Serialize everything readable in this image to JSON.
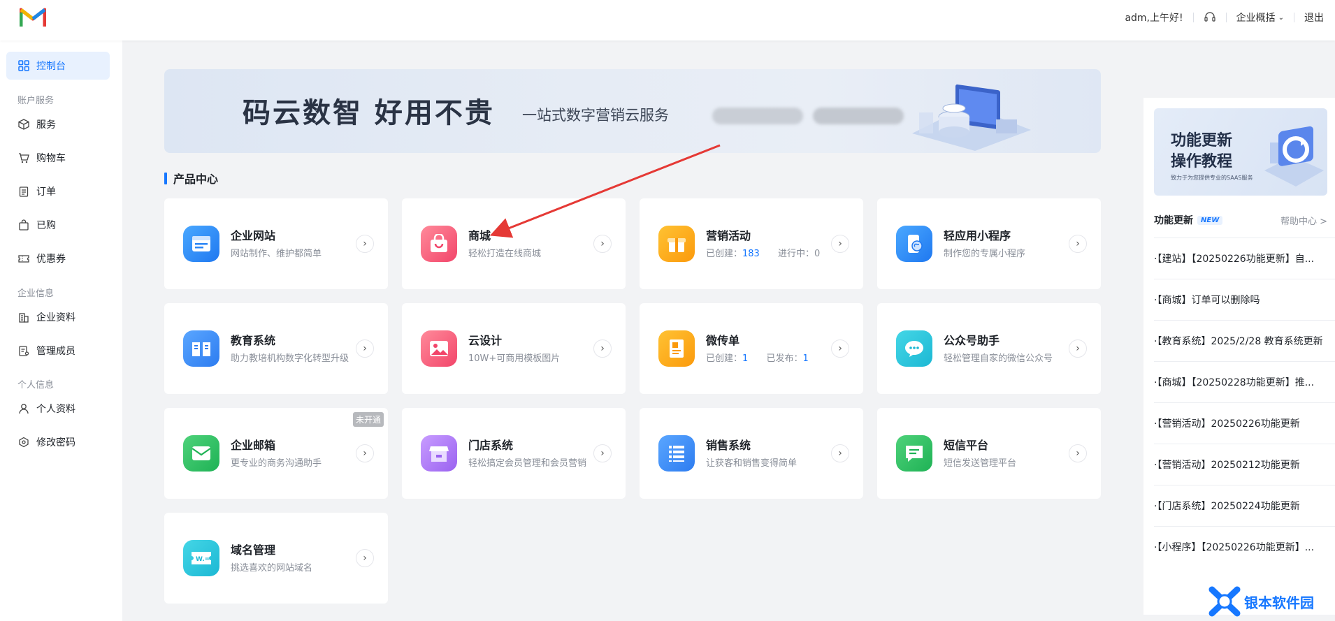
{
  "header": {
    "greeting": "adm,上午好!",
    "overview_label": "企业概括",
    "logout_label": "退出"
  },
  "sidebar": {
    "console_label": "控制台",
    "group_account": "账户服务",
    "service_label": "服务",
    "cart_label": "购物车",
    "orders_label": "订单",
    "purchased_label": "已购",
    "coupons_label": "优惠券",
    "group_company": "企业信息",
    "company_profile_label": "企业资料",
    "members_label": "管理成员",
    "group_personal": "个人信息",
    "personal_profile_label": "个人资料",
    "password_label": "修改密码"
  },
  "banner": {
    "title": "码云数智  好用不贵",
    "subtitle": "一站式数字营销云服务"
  },
  "product_center": {
    "title": "产品中心",
    "products": [
      {
        "name": "企业网站",
        "desc": "网站制作、维护都简单"
      },
      {
        "name": "商城",
        "desc": "轻松打造在线商城"
      },
      {
        "name": "营销活动",
        "desc_created_label": "已创建：",
        "desc_created": "183",
        "desc_running_label": "进行中：",
        "desc_running": "0"
      },
      {
        "name": "轻应用小程序",
        "desc": "制作您的专属小程序"
      },
      {
        "name": "教育系统",
        "desc": "助力教培机构数字化转型升级"
      },
      {
        "name": "云设计",
        "desc": "10W+可商用模板图片"
      },
      {
        "name": "微传单",
        "desc_created_label": "已创建：",
        "desc_created": "1",
        "desc_published_label": "已发布：",
        "desc_published": "1"
      },
      {
        "name": "公众号助手",
        "desc": "轻松管理自家的微信公众号"
      },
      {
        "name": "企业邮箱",
        "desc": "更专业的商务沟通助手",
        "badge": "未开通"
      },
      {
        "name": "门店系统",
        "desc": "轻松搞定会员管理和会员营销"
      },
      {
        "name": "销售系统",
        "desc": "让获客和销售变得简单"
      },
      {
        "name": "短信平台",
        "desc": "短信发送管理平台"
      },
      {
        "name": "域名管理",
        "desc": "挑选喜欢的网站域名"
      }
    ]
  },
  "right_panel": {
    "banner_title_1": "功能更新",
    "banner_title_2": "操作教程",
    "banner_caption": "致力于为您提供专业的SAAS服务",
    "updates_title": "功能更新",
    "new_badge": "NEW",
    "help_center": "帮助中心 >",
    "news": [
      "·【建站】【20250226功能更新】自...",
      "·【商城】订单可以删除吗",
      "·【教育系统】2025/2/28 教育系统更新",
      "·【商城】【20250228功能更新】推...",
      "·【营销活动】20250226功能更新",
      "·【营销活动】20250212功能更新",
      "·【门店系统】20250224功能更新",
      "·【小程序】【20250226功能更新】..."
    ]
  },
  "watermark": "银本软件园",
  "colors": {
    "accent": "#1677ff",
    "annotation_arrow": "#e53935"
  }
}
